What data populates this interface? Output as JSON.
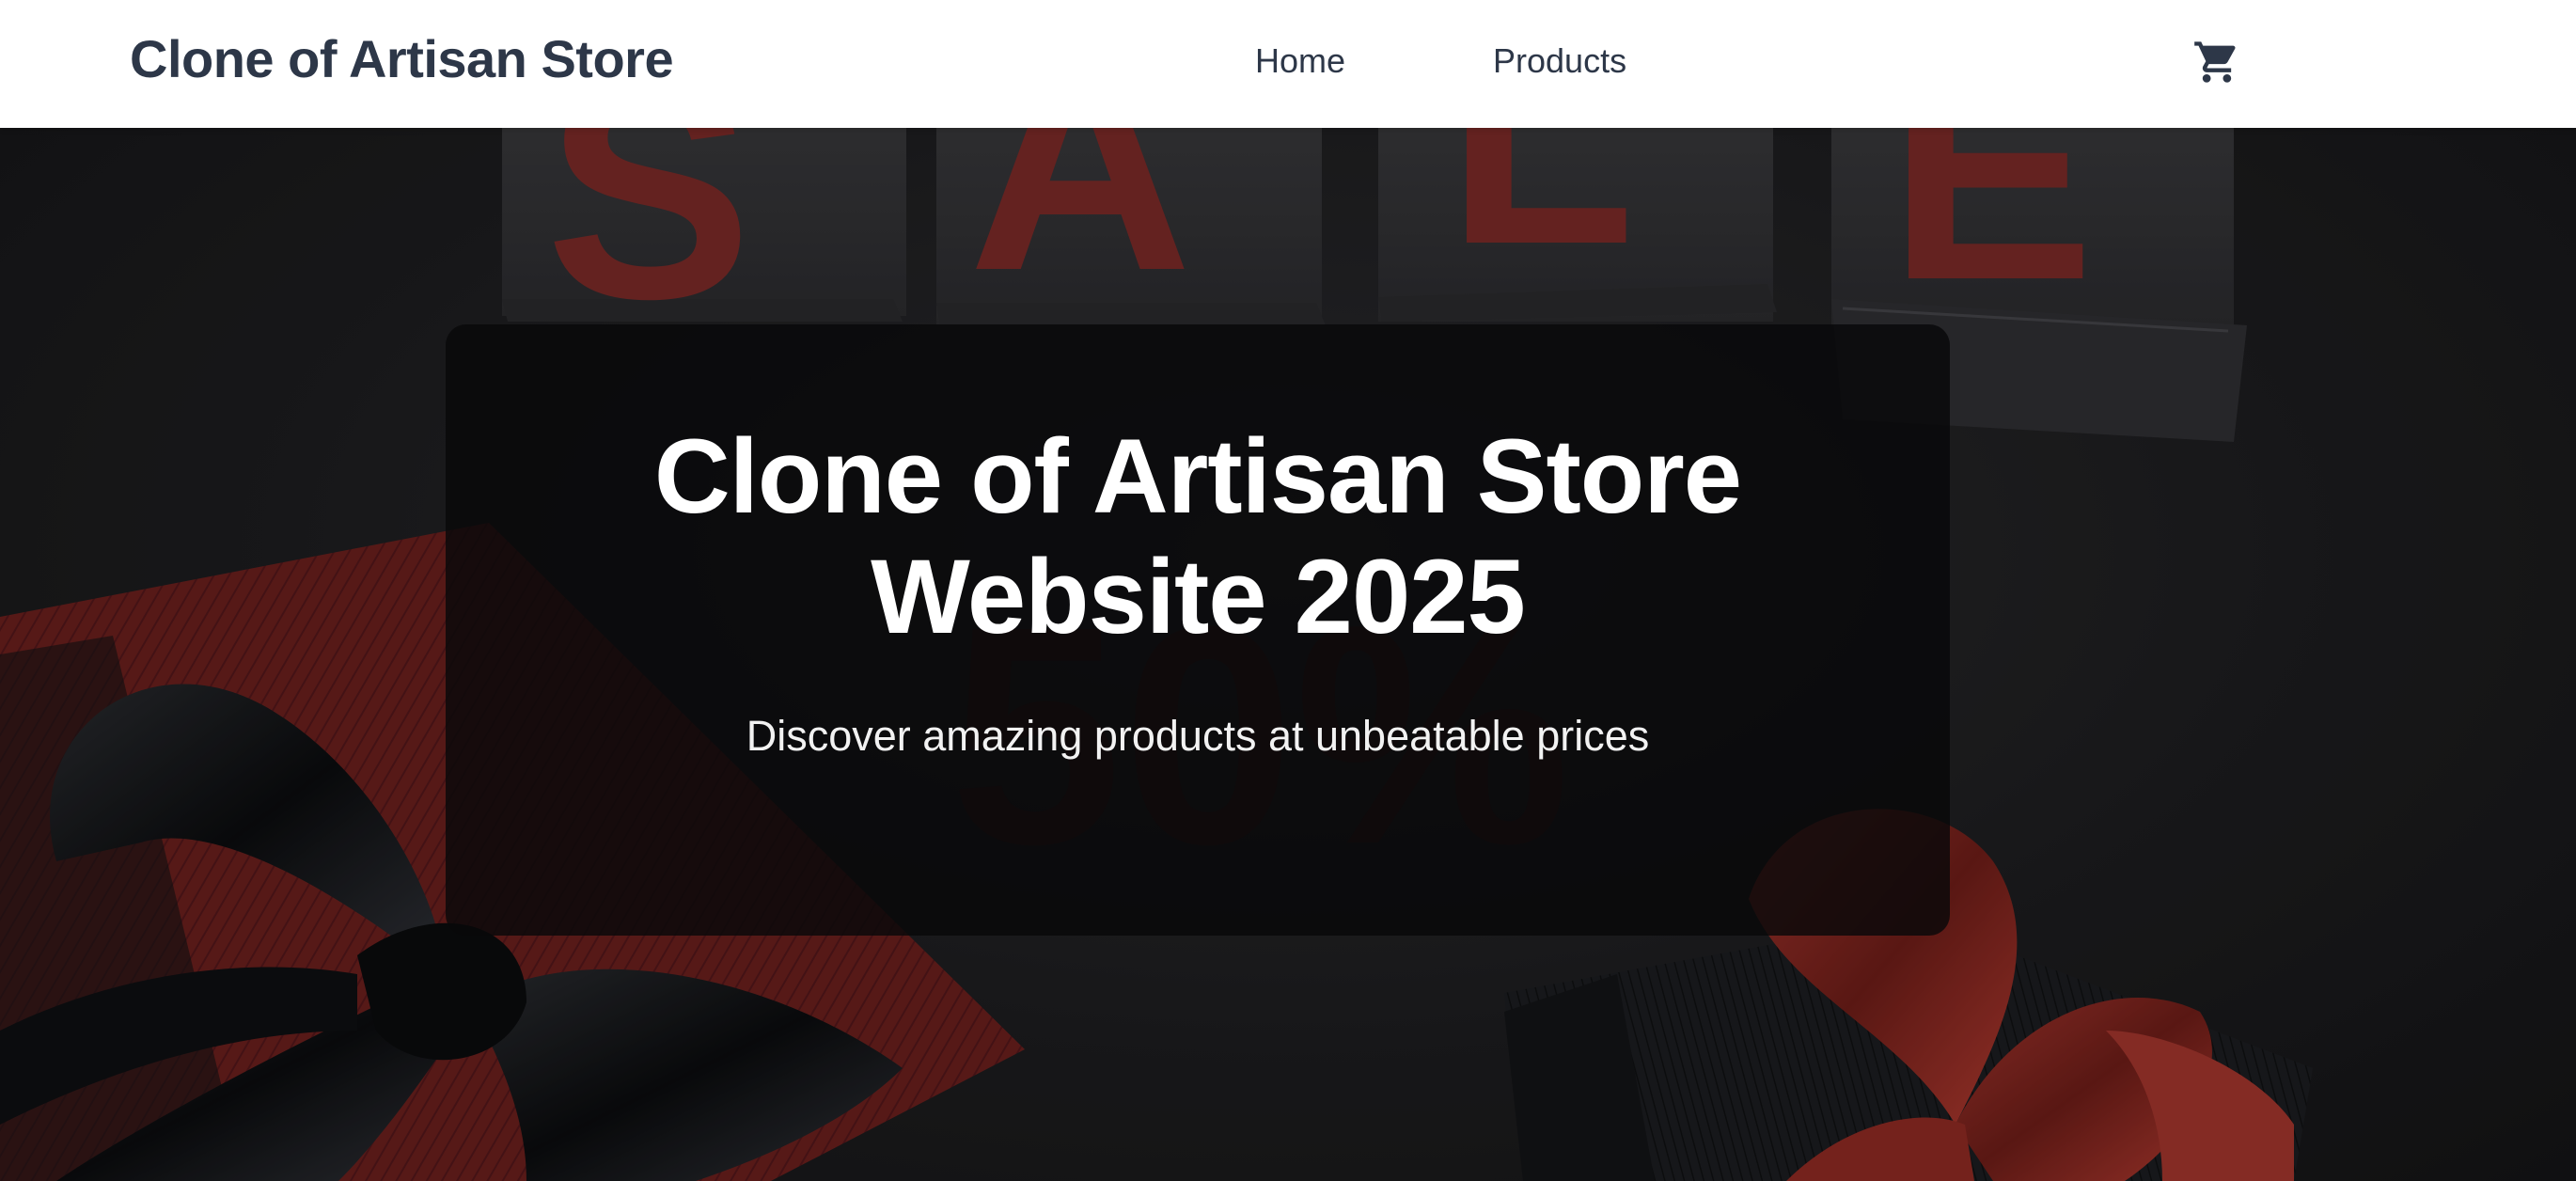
{
  "navbar": {
    "brand": "Clone of Artisan Store",
    "links": [
      {
        "label": "Home"
      },
      {
        "label": "Products"
      }
    ],
    "cart_icon": "shopping-cart-icon"
  },
  "hero": {
    "background_words": {
      "sale_letters": [
        "S",
        "A",
        "L",
        "E"
      ],
      "discount": "50%"
    },
    "title_line1": "Clone of Artisan Store",
    "title_line2": "Website 2025",
    "subtitle": "Discover amazing products at unbeatable prices"
  },
  "colors": {
    "nav_bg": "#ffffff",
    "nav_text": "#2d3748",
    "hero_bg": "#1d1d1f",
    "accent_red": "#8b2a26",
    "card_bg": "#08080a",
    "hero_text": "#ffffff"
  }
}
